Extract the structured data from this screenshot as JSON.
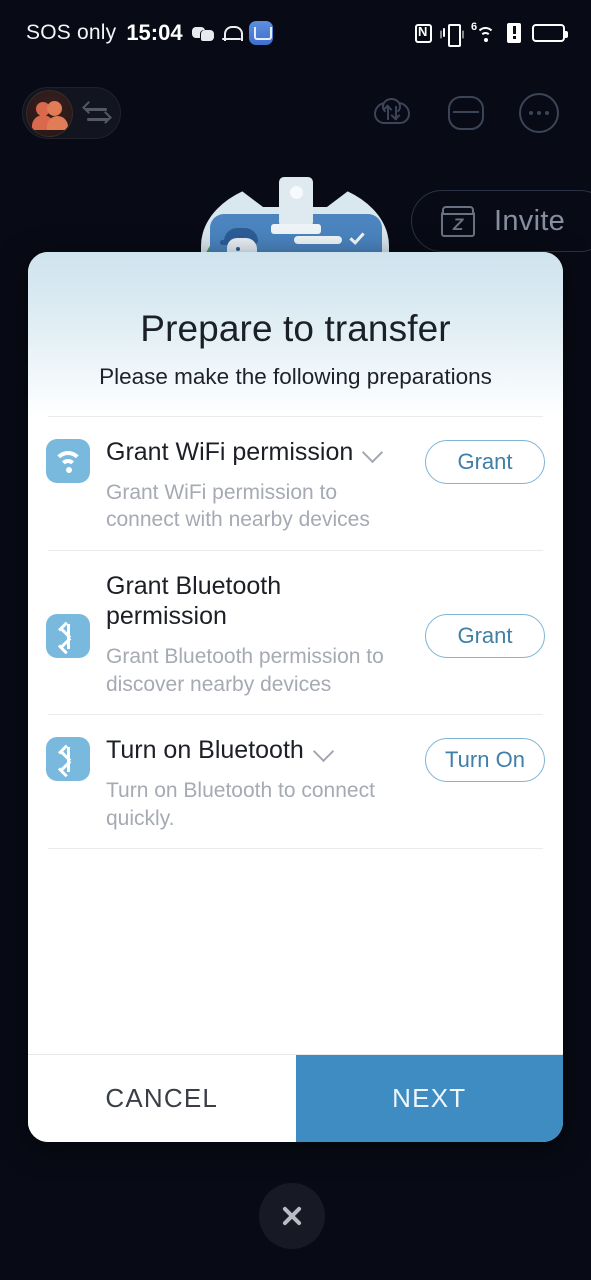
{
  "statusbar": {
    "carrier": "SOS only",
    "time": "15:04",
    "left_icons": [
      "chat-icon",
      "bell-icon",
      "mail-icon"
    ],
    "right_icons": [
      "nfc-icon",
      "vibrate-icon",
      "wifi-6g-icon",
      "sim-alert-icon",
      "battery-icon"
    ],
    "wifi_generation": "6"
  },
  "topnav": {
    "avatar_label": "",
    "icons": [
      "cloud-transfer-icon",
      "device-icon",
      "more-options-icon"
    ]
  },
  "invite": {
    "label": "Invite",
    "icon": "zapya-box-icon"
  },
  "dialog": {
    "title": "Prepare to transfer",
    "subtitle": "Please make the following preparations",
    "rows": [
      {
        "icon": "wifi-icon",
        "title": "Grant WiFi permission",
        "description": "Grant WiFi permission to connect with nearby devices",
        "action": "Grant",
        "has_chevron": true
      },
      {
        "icon": "bluetooth-icon",
        "title": "Grant Bluetooth permission",
        "description": "Grant Bluetooth permission to discover nearby devices",
        "action": "Grant",
        "has_chevron": false
      },
      {
        "icon": "bluetooth-icon",
        "title": "Turn on Bluetooth",
        "description": "Turn on Bluetooth to connect quickly.",
        "action": "Turn On",
        "has_chevron": true
      }
    ],
    "cancel_label": "CANCEL",
    "next_label": "NEXT"
  },
  "close_button": {
    "icon": "close-icon"
  },
  "colors": {
    "accent_blue": "#3e8cc2",
    "button_outline": "#7fb4d4",
    "button_text": "#3f7fa8",
    "icon_tile": "#79b9dd",
    "page_background": "#080b15",
    "dialog_gradient_top": "#cfe3ee"
  }
}
